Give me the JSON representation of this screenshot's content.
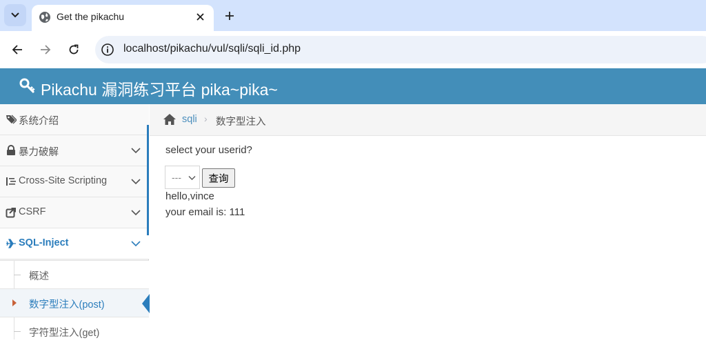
{
  "browser": {
    "tab_title": "Get the pikachu",
    "url": "localhost/pikachu/vul/sqli/sqli_id.php"
  },
  "header": {
    "brand": "Pikachu 漏洞练习平台 pika~pika~"
  },
  "sidebar": {
    "items": [
      {
        "label": "系统介绍",
        "icon": "tags-icon"
      },
      {
        "label": "暴力破解",
        "icon": "lock-icon"
      },
      {
        "label": "Cross-Site Scripting",
        "icon": "list-icon"
      },
      {
        "label": "CSRF",
        "icon": "share-icon"
      },
      {
        "label": "SQL-Inject",
        "icon": "plane-icon"
      }
    ],
    "submenu": [
      {
        "label": "概述"
      },
      {
        "label": "数字型注入(post)"
      },
      {
        "label": "字符型注入(get)"
      }
    ]
  },
  "breadcrumb": {
    "link": "sqli",
    "separator": "›",
    "current": "数字型注入"
  },
  "main": {
    "question": "select your userid?",
    "select_value": "---",
    "button_label": "查询",
    "result_hello": "hello,vince",
    "result_email": "your email is: 111"
  },
  "colors": {
    "header_bg": "#438eb9",
    "active_link": "#2b7dbc",
    "tabbar_bg": "#d3e3fd"
  }
}
